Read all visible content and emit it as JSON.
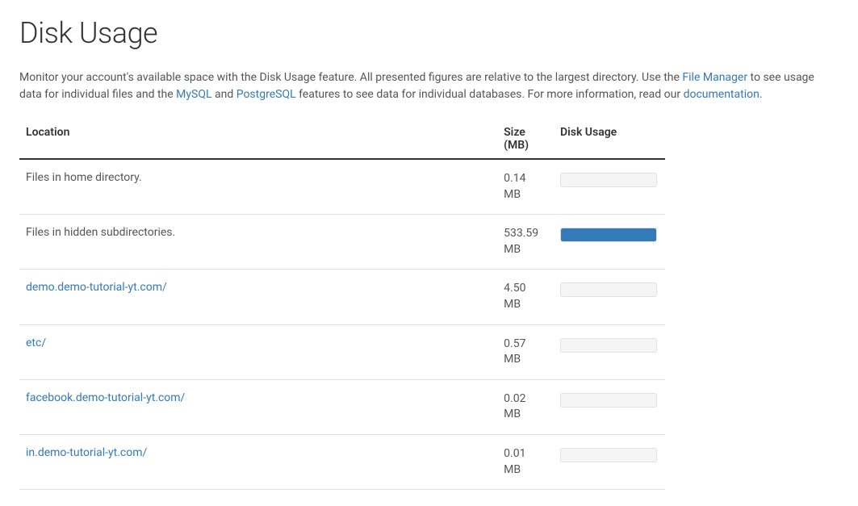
{
  "page": {
    "title": "Disk Usage",
    "description_parts": {
      "p1": "Monitor your account's available space with the Disk Usage feature. All presented figures are relative to the largest directory. Use the ",
      "link_file_manager": "File Manager",
      "p2": " to see usage data for individual files and the ",
      "link_mysql": "MySQL",
      "p3": " and ",
      "link_postgresql": "PostgreSQL",
      "p4": " features to see data for individual databases. For more information, read our ",
      "link_documentation": "documentation",
      "p5": "."
    }
  },
  "table": {
    "headers": {
      "location": "Location",
      "size": "Size (MB)",
      "usage": "Disk Usage"
    },
    "rows": [
      {
        "location": "Files in home directory.",
        "is_link": false,
        "size": "0.14 MB",
        "bar_percent": 0
      },
      {
        "location": "Files in hidden subdirectories.",
        "is_link": false,
        "size": "533.59 MB",
        "bar_percent": 100
      },
      {
        "location": "demo.demo-tutorial-yt.com/",
        "is_link": true,
        "size": "4.50 MB",
        "bar_percent": 0
      },
      {
        "location": "etc/",
        "is_link": true,
        "size": "0.57 MB",
        "bar_percent": 0
      },
      {
        "location": "facebook.demo-tutorial-yt.com/",
        "is_link": true,
        "size": "0.02 MB",
        "bar_percent": 0
      },
      {
        "location": "in.demo-tutorial-yt.com/",
        "is_link": true,
        "size": "0.01 MB",
        "bar_percent": 0
      }
    ]
  }
}
